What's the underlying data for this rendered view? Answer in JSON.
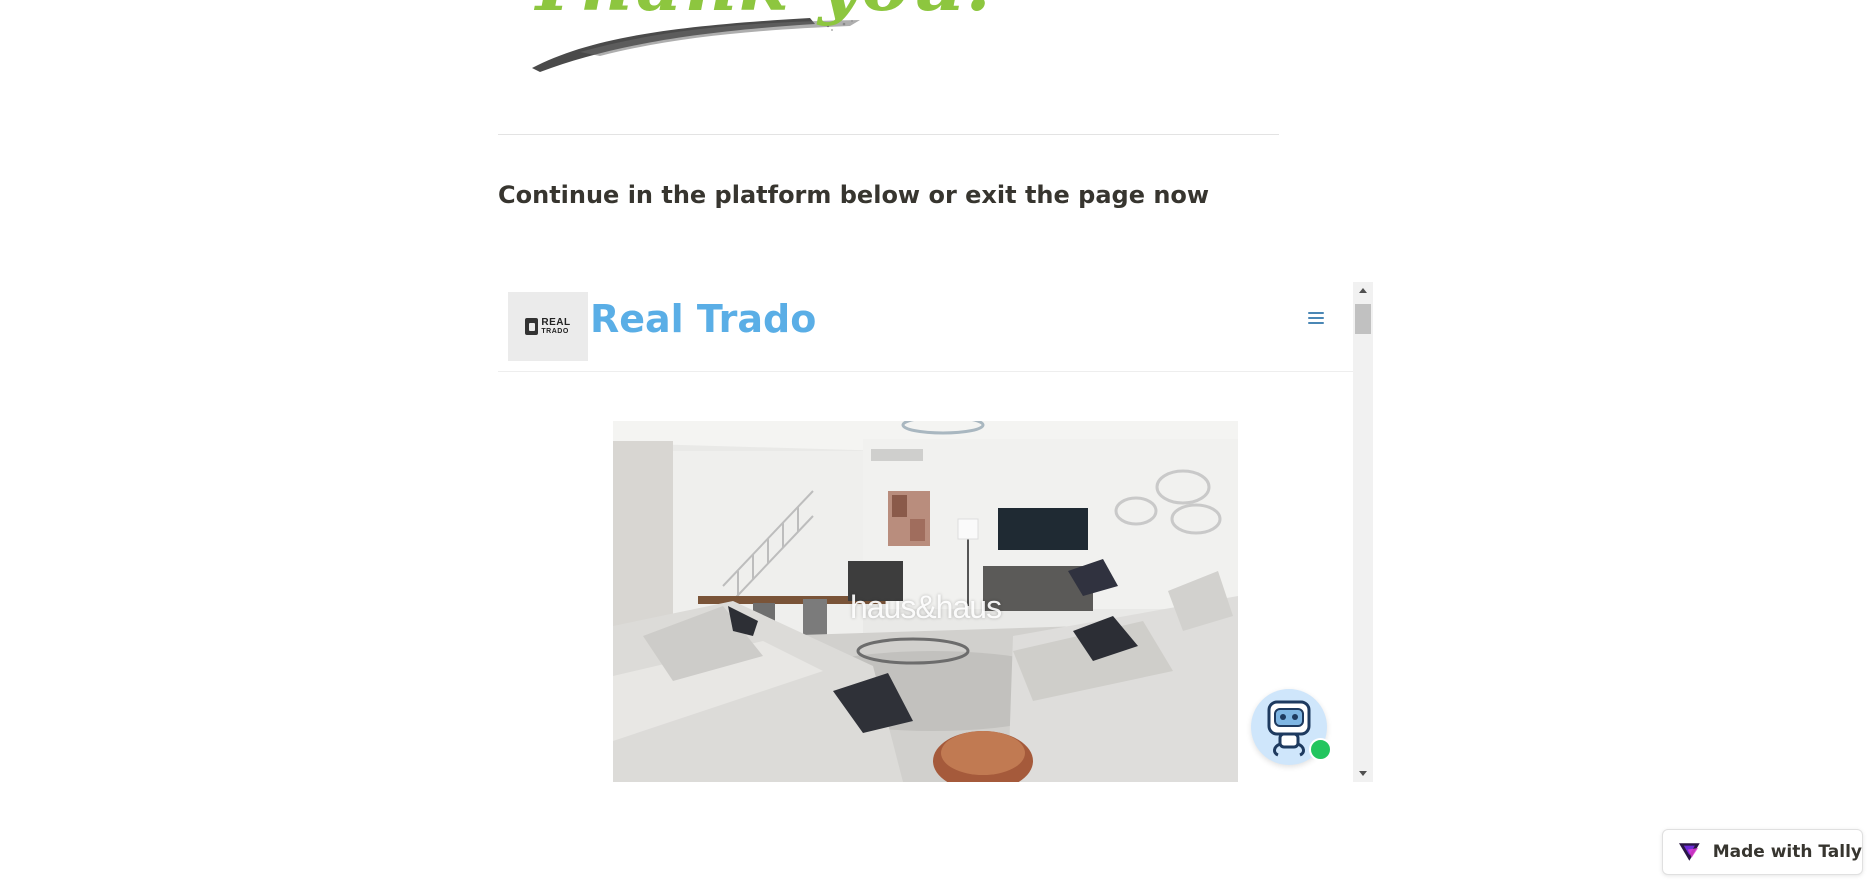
{
  "header": {
    "thank_you_text": "Thank you!"
  },
  "main": {
    "heading": "Continue in the platform below or exit the page now"
  },
  "embed": {
    "brand_title": "Real Trado",
    "logo_line1": "REAL",
    "logo_line2": "TRADO",
    "menu_icon": "hamburger-menu-icon",
    "photo_watermark": "haus&haus",
    "chat_icon": "robot-chat-icon",
    "chat_status_color": "#22c55e"
  },
  "badge": {
    "label": "Made with Tally",
    "icon": "tally-logo-icon"
  },
  "colors": {
    "brand_blue": "#5aaee6",
    "thank_you_green": "#8dc63f",
    "heading": "#37352f"
  }
}
